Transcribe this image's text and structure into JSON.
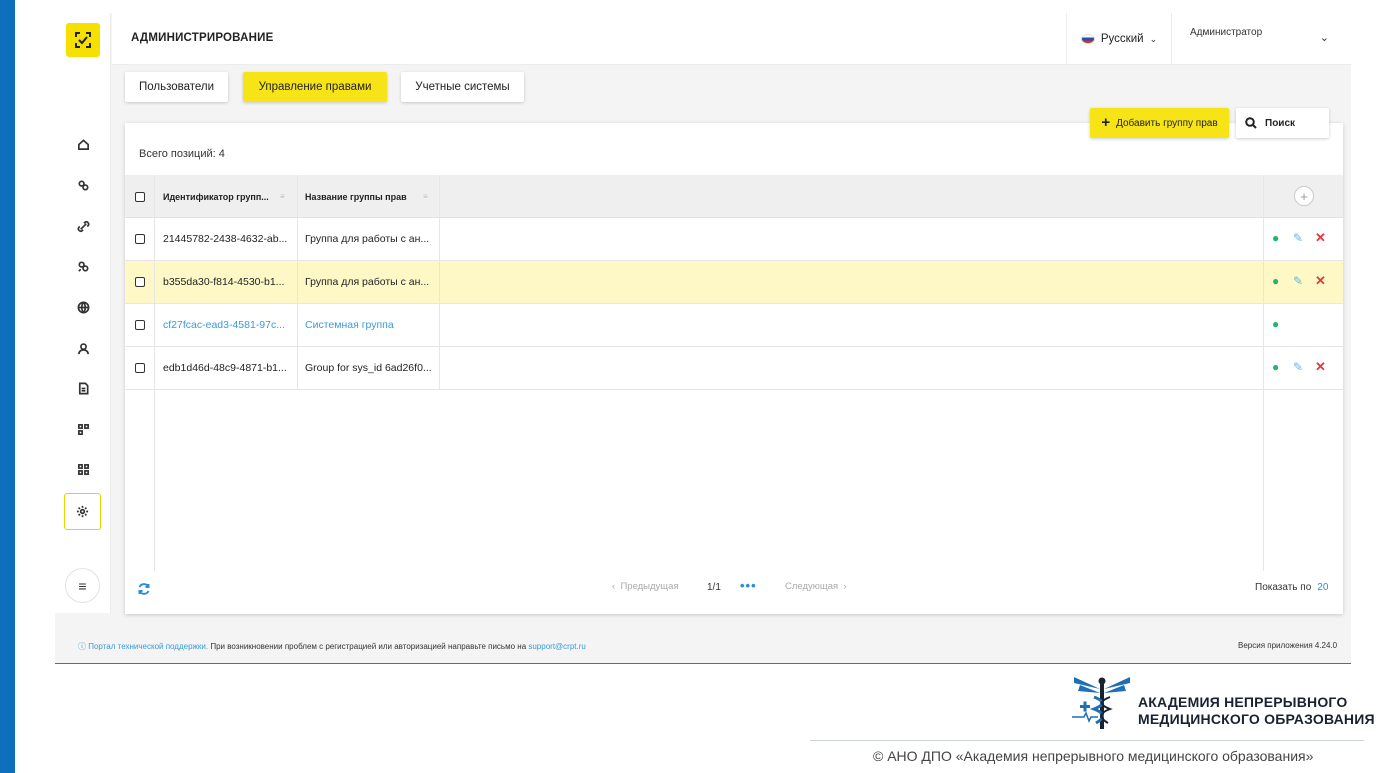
{
  "header": {
    "title": "АДМИНИСТРИРОВАНИЕ",
    "language": "Русский",
    "user": "Администратор"
  },
  "tabs": [
    {
      "label": "Пользователи",
      "active": false
    },
    {
      "label": "Управление правами",
      "active": true
    },
    {
      "label": "Учетные системы",
      "active": false
    }
  ],
  "actions": {
    "add_label": "Добавить группу прав",
    "search_label": "Поиск"
  },
  "table": {
    "total_label": "Всего позиций: 4",
    "columns": [
      "Идентификатор групп...",
      "Название группы прав"
    ],
    "rows": [
      {
        "id": "21445782-2438-4632-ab...",
        "name": "Группа для работы с ан...",
        "editable": true,
        "highlighted": false,
        "system": false
      },
      {
        "id": "b355da30-f814-4530-b1...",
        "name": "Группа для работы с ан...",
        "editable": true,
        "highlighted": true,
        "system": false
      },
      {
        "id": "cf27fcac-ead3-4581-97c...",
        "name": "Системная группа",
        "editable": false,
        "highlighted": false,
        "system": true
      },
      {
        "id": "edb1d46d-48c9-4871-b1...",
        "name": "Group for sys_id 6ad26f0...",
        "editable": true,
        "highlighted": false,
        "system": false
      }
    ]
  },
  "pagination": {
    "prev": "Предыдущая",
    "page": "1/1",
    "next": "Следующая",
    "per_page_label": "Показать по",
    "per_page_value": "20"
  },
  "footer": {
    "support_link": "Портал технической поддержки.",
    "support_text": " При возникновении проблем с регистрацией или авторизацией направьте письмо на ",
    "support_email": "support@crpt.ru",
    "version": "Версия приложения 4.24.0"
  },
  "branding": {
    "name_line1": "АКАДЕМИЯ НЕПРЕРЫВНОГО",
    "name_line2": "МЕДИЦИНСКОГО ОБРАЗОВАНИЯ",
    "credit": "© АНО ДПО «Академия непрерывного медицинского образования»"
  },
  "icons": {
    "sidebar": [
      "home-icon",
      "link-icon",
      "chain-icon",
      "unlink-icon",
      "globe-icon",
      "user-icon",
      "document-icon",
      "modules-icon",
      "grid-icon",
      "gear-icon"
    ],
    "accent": "#f7e417",
    "link_color": "#3a9bd6"
  }
}
